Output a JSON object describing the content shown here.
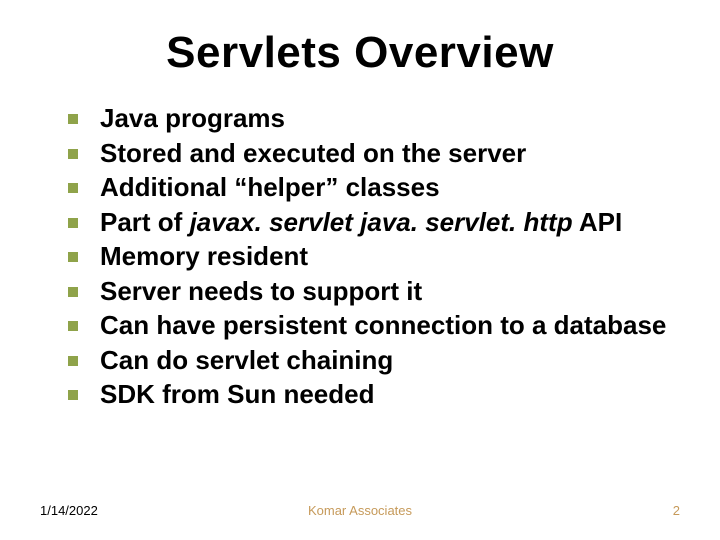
{
  "title": "Servlets Overview",
  "bullets": [
    {
      "text": "Java programs"
    },
    {
      "text": "Stored and executed on the server"
    },
    {
      "text": "Additional “helper” classes"
    },
    {
      "prefix": "Part of ",
      "italic": "javax. servlet  java. servlet. http",
      "suffix": " API"
    },
    {
      "text": "Memory resident"
    },
    {
      "text": "Server needs to support it"
    },
    {
      "text": "Can have persistent connection to a database"
    },
    {
      "text": "Can do servlet chaining"
    },
    {
      "text": "SDK from Sun needed"
    }
  ],
  "footer": {
    "date": "1/14/2022",
    "org": "Komar Associates",
    "page": "2"
  }
}
